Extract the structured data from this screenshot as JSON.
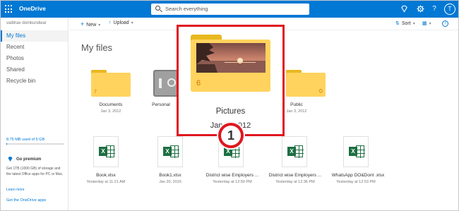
{
  "header": {
    "app_title": "OneDrive",
    "search_placeholder": "Search everything",
    "avatar_initial": "T"
  },
  "sidebar": {
    "user_name": "vaibhav domkundwar",
    "items": [
      {
        "label": "My files",
        "active": true
      },
      {
        "label": "Recent",
        "active": false
      },
      {
        "label": "Photos",
        "active": false
      },
      {
        "label": "Shared",
        "active": false
      },
      {
        "label": "Recycle bin",
        "active": false
      }
    ],
    "storage_text": "8.75 MB used of 5 GB",
    "storage_fraction": 0.002,
    "premium_title": "Go premium",
    "premium_desc": "Get 1TB (1000 GB) of storage and the latest Office apps for PC or Mac.",
    "learn_more": "Learn more",
    "get_apps": "Get the OneDrive apps"
  },
  "commandbar": {
    "new_label": "New",
    "upload_label": "Upload",
    "sort_label": "Sort"
  },
  "main": {
    "title": "My files",
    "folders": [
      {
        "name": "Documents",
        "date": "Jan 3, 2012"
      },
      {
        "name": "Personal",
        "date": ""
      },
      {
        "name": "Public",
        "date": "Jan 3, 2012"
      }
    ],
    "files": [
      {
        "name": "Book.xlsx",
        "date": "Yesterday at 11:21 AM"
      },
      {
        "name": "Book1.xlsx",
        "date": "Jan 20, 2015"
      },
      {
        "name": "District wise Employers ...",
        "date": "Yesterday at 12:50 PM"
      },
      {
        "name": "District wise Employers ...",
        "date": "Yesterday at 12:36 PM"
      },
      {
        "name": "WhatsApp DO&Dont .xlsx",
        "date": "Yesterday at 12:53 PM"
      }
    ]
  },
  "highlight": {
    "folder_name": "Pictures",
    "folder_date": "Jan 3, 2012",
    "item_count": "6",
    "step_number": "1"
  },
  "colors": {
    "brand_blue": "#0078d4",
    "folder_yellow": "#ffd35e",
    "excel_green": "#1d6f42",
    "highlight_red": "#e0171f"
  }
}
